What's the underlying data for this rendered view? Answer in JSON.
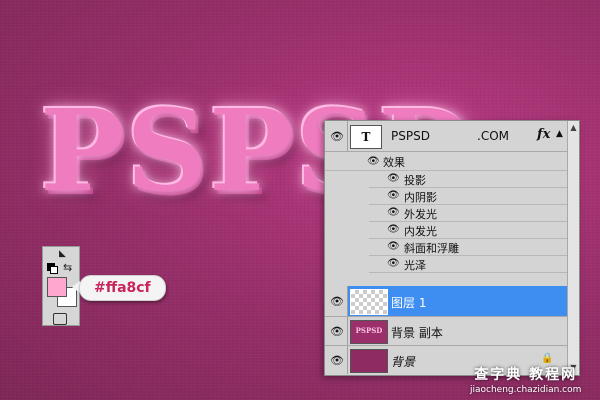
{
  "canvas": {
    "artwork_text": "PSPSD"
  },
  "toolbox": {
    "foreground_color": "#ffa8cf",
    "background_color": "#ffffff",
    "swap_icon": "swap-arrows-icon",
    "default_icon": "default-colors-icon"
  },
  "color_tag": {
    "text": "#ffa8cf"
  },
  "layers_panel": {
    "text_layer": {
      "thumb_letter": "T",
      "name": "PSPSD",
      "name_suffix": ".COM",
      "fx_badge": "fx",
      "effects_header": "效果",
      "effects": [
        "投影",
        "内阴影",
        "外发光",
        "内发光",
        "斜面和浮雕",
        "光泽"
      ]
    },
    "layer1": {
      "name": "图层 1"
    },
    "bg_copy": {
      "name": "背景 副本",
      "thumb_text": "PSPSD"
    },
    "background": {
      "name": "背景",
      "lock_icon": "lock-icon"
    }
  },
  "watermark": {
    "line1": "查字典 教程网",
    "line2": "jiaocheng.chazidian.com"
  },
  "colors": {
    "selection": "#3d8ef0",
    "accent_pink": "#ffa8cf"
  }
}
